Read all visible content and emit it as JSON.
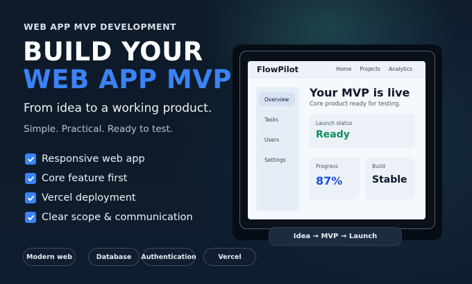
{
  "hero": {
    "kicker": "WEB APP MVP DEVELOPMENT",
    "headline_line1": "BUILD YOUR",
    "headline_line2": "WEB APP MVP",
    "subtitle": "From idea to a working product.",
    "tagline": "Simple. Practical. Ready to test."
  },
  "features": [
    "Responsive web app",
    "Core feature first",
    "Vercel deployment",
    "Clear scope & communication"
  ],
  "tags": [
    "Modern web",
    "Database",
    "Authentication",
    "Vercel"
  ],
  "mockup": {
    "brand": "FlowPilot",
    "nav": [
      "Home",
      "Projects",
      "Analytics"
    ],
    "sidebar": [
      "Overview",
      "Tasks",
      "Users",
      "Settings"
    ],
    "active_sidebar": "Overview",
    "title": "Your MVP is live",
    "subtitle": "Core product ready for testing.",
    "launch_status": {
      "label": "Launch status",
      "value": "Ready"
    },
    "progress": {
      "label": "Progress",
      "value": "87%"
    },
    "build": {
      "label": "Build",
      "value": "Stable"
    }
  },
  "flow_pill": "Idea  →  MVP  →  Launch",
  "colors": {
    "accent_blue": "#3b82f6",
    "ready_green": "#0f8f5f",
    "progress_blue": "#1d4ed8",
    "background": "#0e1b2a"
  }
}
